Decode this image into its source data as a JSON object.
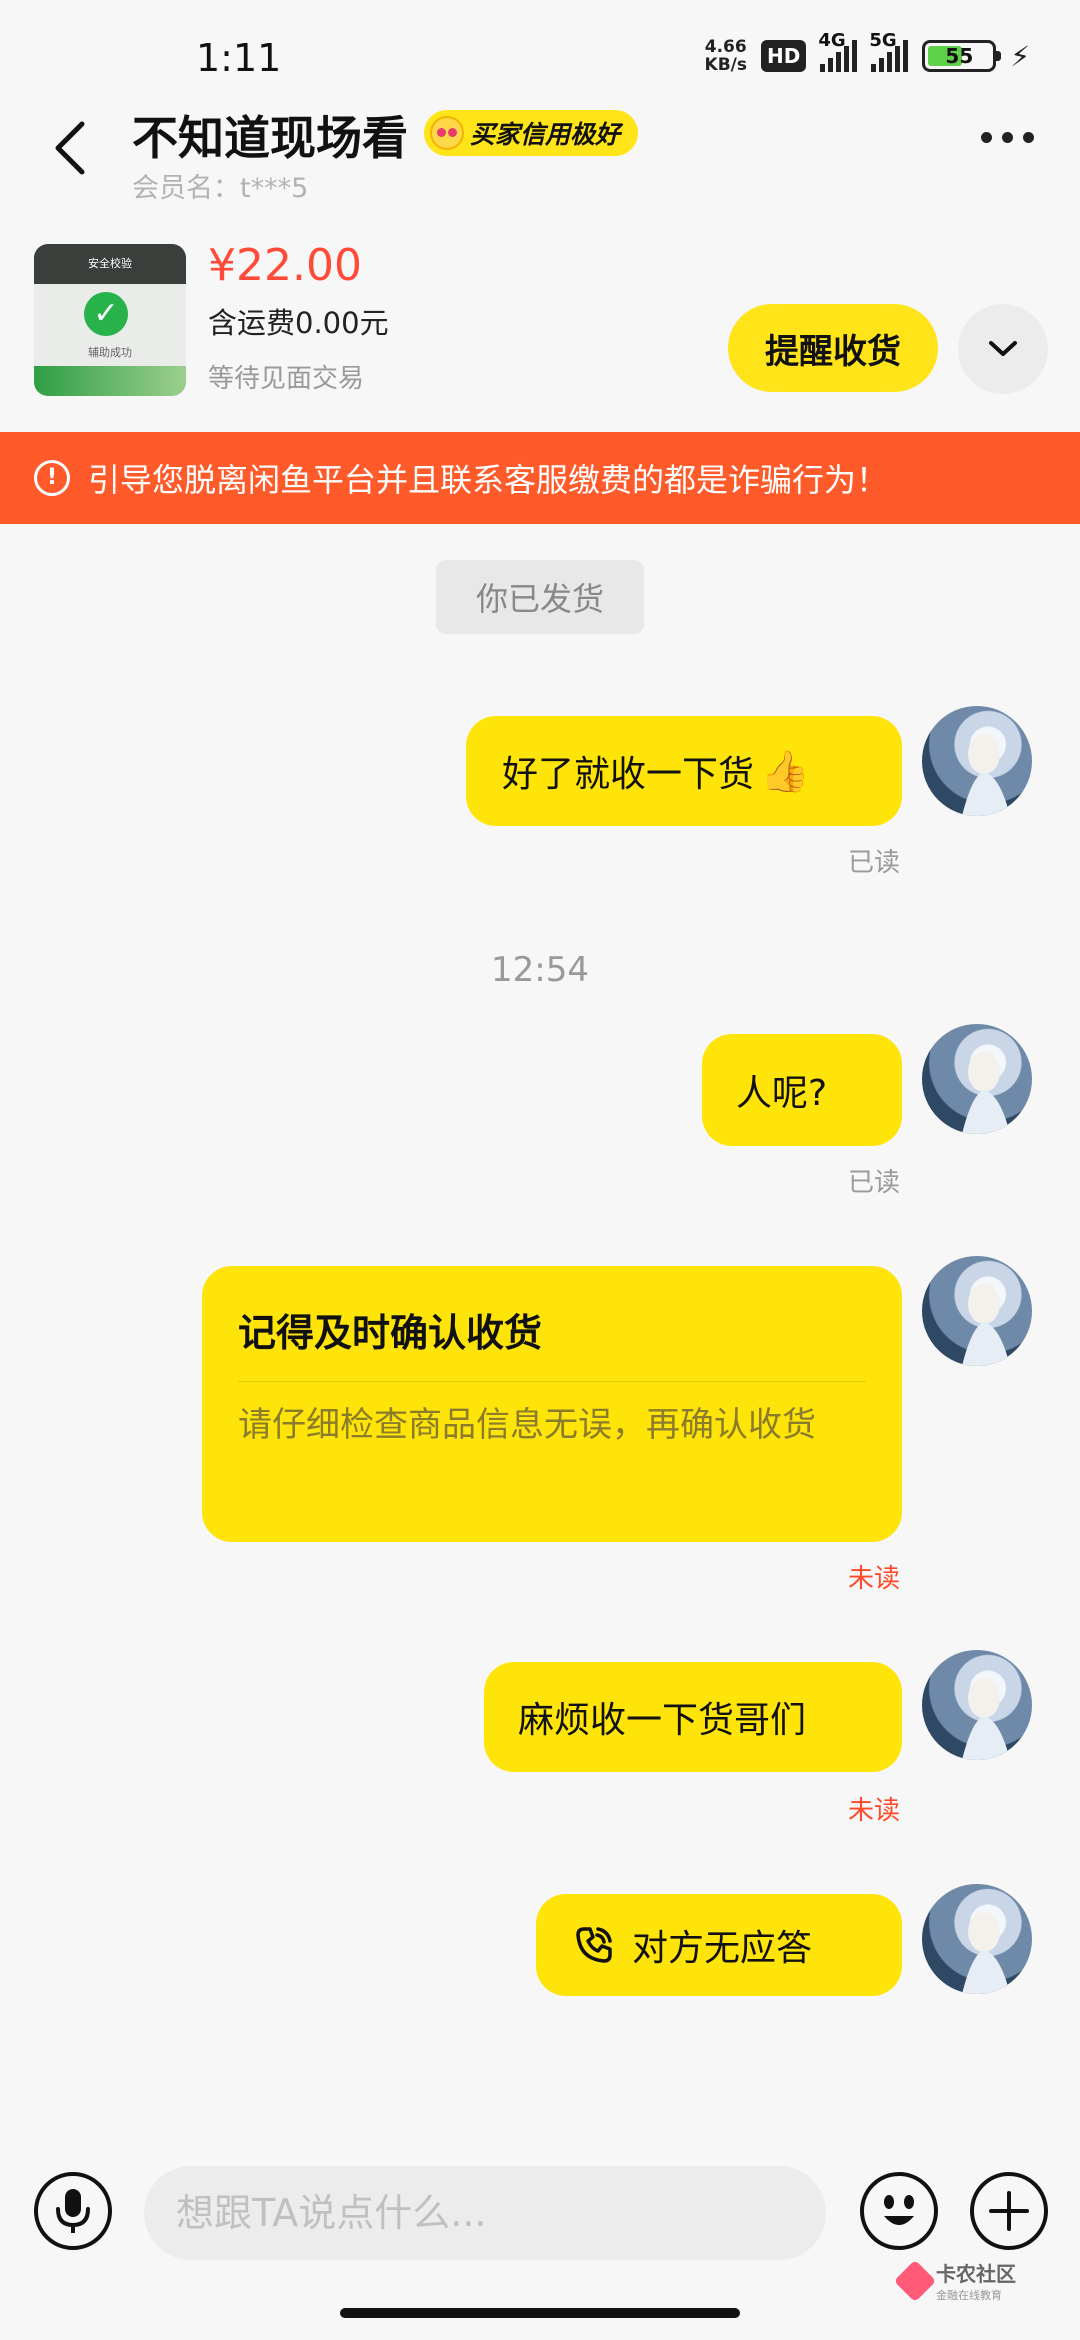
{
  "status_bar": {
    "time": "1:11",
    "net_speed_value": "4.66",
    "net_speed_unit": "KB/s",
    "hd_label": "HD",
    "network_1": "4G",
    "network_2": "5G",
    "battery": "55"
  },
  "header": {
    "title": "不知道现场看",
    "credit_badge": "买家信用极好",
    "member_label": "会员名：t***5"
  },
  "product": {
    "price": "¥22.00",
    "shipping": "含运费0.00元",
    "status": "等待见面交易",
    "thumb_top_text": "安全校验",
    "thumb_label": "辅助成功",
    "remind_button": "提醒收货"
  },
  "warning": {
    "text": "引导您脱离闲鱼平台并且联系客服缴费的都是诈骗行为！"
  },
  "chat": {
    "system_chip": "你已发货",
    "timestamp": "12:54",
    "messages": [
      {
        "text": "好了就收一下货",
        "emoji": "👍",
        "status": "已读"
      },
      {
        "text": "人呢?",
        "status": "已读"
      },
      {
        "card_title": "记得及时确认收货",
        "card_body": "请仔细检查商品信息无误，再确认收货",
        "status": "未读"
      },
      {
        "text": "麻烦收一下货哥们",
        "status": "未读"
      },
      {
        "text": "对方无应答",
        "icon": "phone-call-icon"
      }
    ]
  },
  "input_bar": {
    "placeholder": "想跟TA说点什么..."
  },
  "watermark": {
    "name": "卡农社区",
    "sub": "金融在线教育"
  },
  "colors": {
    "accent_yellow": "#ffe40a",
    "warning_orange": "#ff5a2a",
    "price_red": "#ff4a3a",
    "unread_red": "#ff4a2a"
  }
}
